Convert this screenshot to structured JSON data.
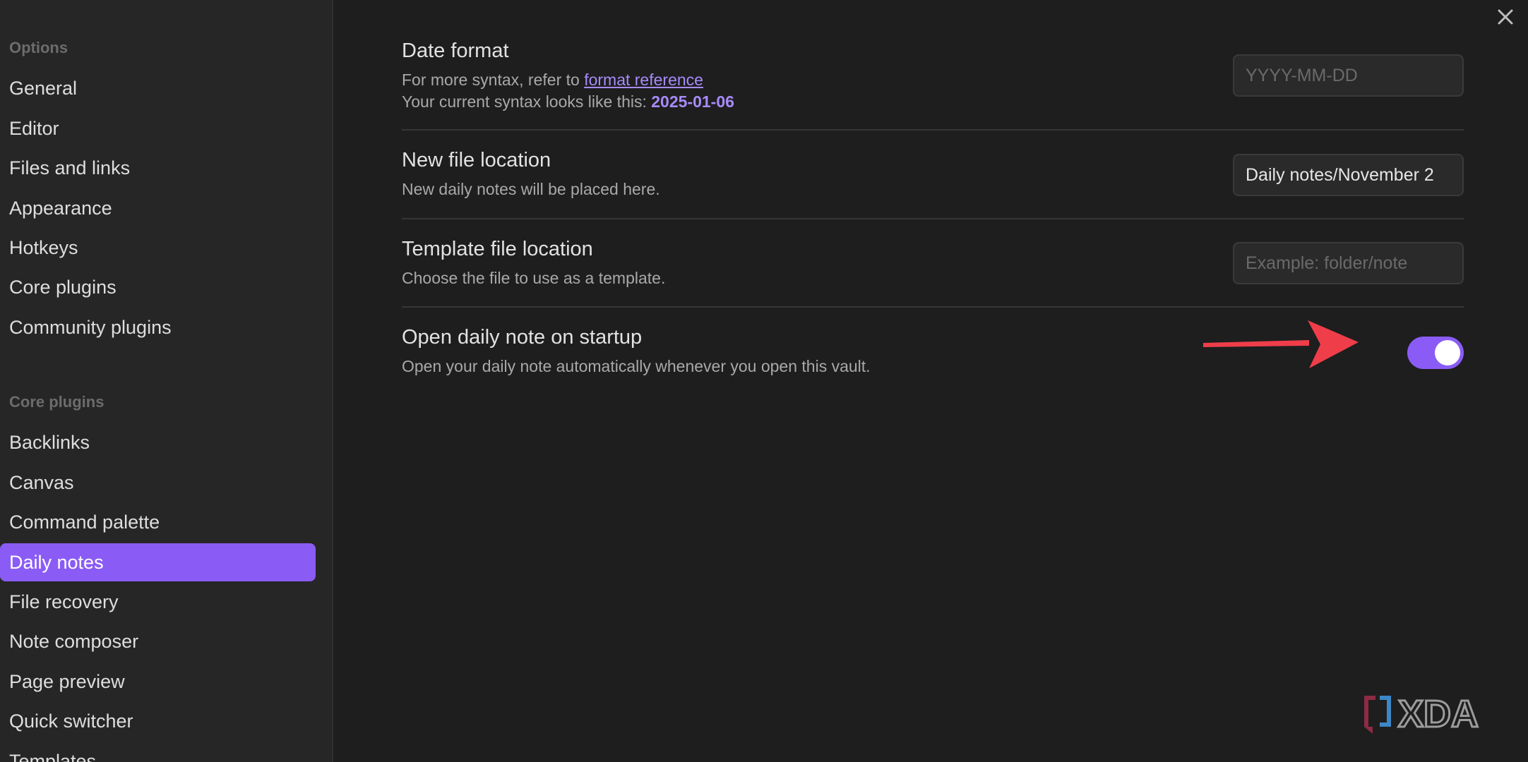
{
  "sidebar": {
    "options_title": "Options",
    "options_items": [
      {
        "label": "General"
      },
      {
        "label": "Editor"
      },
      {
        "label": "Files and links"
      },
      {
        "label": "Appearance"
      },
      {
        "label": "Hotkeys"
      },
      {
        "label": "Core plugins"
      },
      {
        "label": "Community plugins"
      }
    ],
    "core_title": "Core plugins",
    "core_items": [
      {
        "label": "Backlinks"
      },
      {
        "label": "Canvas"
      },
      {
        "label": "Command palette"
      },
      {
        "label": "Daily notes",
        "active": true
      },
      {
        "label": "File recovery"
      },
      {
        "label": "Note composer"
      },
      {
        "label": "Page preview"
      },
      {
        "label": "Quick switcher"
      },
      {
        "label": "Templates"
      }
    ]
  },
  "settings": {
    "date_format": {
      "name": "Date format",
      "desc_prefix": "For more syntax, refer to ",
      "desc_link": "format reference",
      "desc_line2_prefix": "Your current syntax looks like this: ",
      "current_value": "2025-01-06",
      "placeholder": "YYYY-MM-DD"
    },
    "new_file_location": {
      "name": "New file location",
      "desc": "New daily notes will be placed here.",
      "value": "Daily notes/November 2"
    },
    "template_file_location": {
      "name": "Template file location",
      "desc": "Choose the file to use as a template.",
      "placeholder": "Example: folder/note"
    },
    "open_on_startup": {
      "name": "Open daily note on startup",
      "desc": "Open your daily note automatically whenever you open this vault.",
      "enabled": true
    }
  },
  "watermark": {
    "text": "XDA"
  },
  "colors": {
    "accent": "#8a5cf5",
    "accent_text": "#a78bfa",
    "arrow": "#ef3e4a"
  },
  "icons": {
    "close": "close-icon",
    "arrow": "red-arrow-annotation",
    "logo": "xda-logo"
  }
}
